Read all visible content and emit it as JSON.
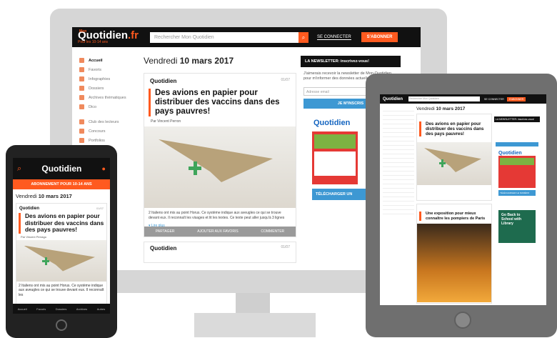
{
  "desktop": {
    "logo": {
      "mon": "Mon",
      "main": "Quotidien",
      "ext": ".fr",
      "tagline": "Pour les 10-14 ans"
    },
    "search_placeholder": "Rechercher Mon Quotidien",
    "login": "SE CONNECTER",
    "subscribe": "S'ABONNER",
    "sidebar": [
      {
        "label": "Accueil",
        "icon": "home-icon",
        "active": true
      },
      {
        "label": "Favoris",
        "icon": "star-icon"
      },
      {
        "label": "Infographies",
        "icon": "chart-icon"
      },
      {
        "label": "Dossiers",
        "icon": "folder-icon"
      },
      {
        "label": "Archives thématiques",
        "icon": "archive-icon"
      },
      {
        "label": "Dico",
        "icon": "book-icon"
      },
      {
        "label": "Club des lecteurs",
        "icon": "club-icon"
      },
      {
        "label": "Concours",
        "icon": "trophy-icon"
      },
      {
        "label": "Portfolios",
        "icon": "portfolio-icon"
      }
    ],
    "date": {
      "day": "Vendredi",
      "rest": "10 mars 2017"
    },
    "article": {
      "brand": "Quotidien",
      "page": "01/07",
      "title": "Des avions en papier pour distribuer des vaccins dans des pays pauvres!",
      "author": "Par Vincent Perron",
      "teaser": "2 Italiens ont mis au point Horus. Ce système indique aux aveugles ce qui se trouve devant eux. Il reconnaît les visages et lit les textes. Ce texte peut aller jusqu'à 3 lignes",
      "more": "Lire plus",
      "actions": [
        "PARTAGER",
        "AJOUTER AUX FAVORIS",
        "COMMENTER"
      ]
    },
    "second_page": "01/07",
    "newsletter": {
      "title": "LA NEWSLETTER: inscrivez-vous!",
      "text": "J'aimerais recevoir la newsletter de Mon Quotidien pour m'informer des données actuelles du journal",
      "email_placeholder": "Adresse email",
      "button": "JE M'INSCRIS",
      "download": "TÉLÉCHARGER UN"
    }
  },
  "tablet": {
    "search_placeholder": "Rechercher Mon Quotidien",
    "login": "SE CONNECTER",
    "subscribe": "S'ABONNER",
    "date": {
      "day": "Vendredi",
      "rest": "10 mars 2017"
    },
    "article1_title": "Des avions en papier pour distribuer des vaccins dans des pays pauvres!",
    "article2_title": "Une exposition pour mieux connaître les pompiers de Paris",
    "newsletter": "LA NEWSLETTER: inscrivez-vous!",
    "ad": "Go Back to School with Library",
    "download": "TÉLÉCHARGER LE NUMÉRO"
  },
  "phone": {
    "banner": "ABONNEMENT POUR 10-14 ANS",
    "date": {
      "day": "Vendredi",
      "rest": "10 mars 2017"
    },
    "page": "01/07",
    "title": "Des avions en papier pour distribuer des vaccins dans des pays pauvres!",
    "author": "Par Vincent Perrago",
    "teaser": "2 Italiens ont mis au point Horus. Ce système indique aux aveugles ce qui se trouve devant eux. Il reconnaît les",
    "tabs": [
      "Accueil",
      "Favoris",
      "Dossiers",
      "Archives",
      "Autres"
    ]
  },
  "colors": {
    "accent": "#ff5a1f",
    "dark": "#111111",
    "newsletter_blue": "#3d98d3"
  }
}
